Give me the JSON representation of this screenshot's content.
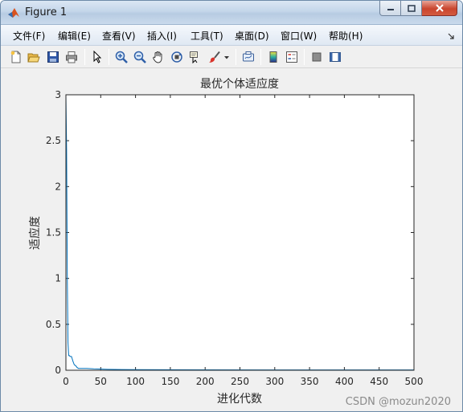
{
  "window": {
    "title": "Figure 1"
  },
  "menu": {
    "items": [
      "文件(F)",
      "编辑(E)",
      "查看(V)",
      "插入(I)",
      "工具(T)",
      "桌面(D)",
      "窗口(W)",
      "帮助(H)"
    ]
  },
  "toolbar": {
    "icons": [
      "new-figure-icon",
      "open-file-icon",
      "save-icon",
      "print-icon",
      "pointer-icon",
      "zoom-in-icon",
      "zoom-out-icon",
      "pan-icon",
      "rotate-3d-icon",
      "data-cursor-icon",
      "brush-icon",
      "brush-dropdown-icon",
      "link-plot-icon",
      "colorbar-icon",
      "legend-icon",
      "hide-plot-tools-icon",
      "show-plot-tools-icon"
    ]
  },
  "chart_data": {
    "type": "line",
    "title": "最优个体适应度",
    "xlabel": "进化代数",
    "ylabel": "适应度",
    "xlim": [
      0,
      500
    ],
    "ylim": [
      0,
      3
    ],
    "xticks": [
      "0",
      "50",
      "100",
      "150",
      "200",
      "250",
      "300",
      "350",
      "400",
      "450",
      "500"
    ],
    "yticks": [
      "0",
      "0.5",
      "1",
      "1.5",
      "2",
      "2.5",
      "3"
    ],
    "grid": false,
    "series": [
      {
        "color": "#0072bd",
        "x": [
          0,
          1,
          2,
          3,
          4,
          5,
          6,
          8,
          10,
          12,
          14,
          16,
          18,
          20,
          25,
          30,
          40,
          60,
          80,
          100,
          150,
          200,
          300,
          400,
          500
        ],
        "y": [
          3.0,
          2.4,
          1.0,
          0.3,
          0.16,
          0.16,
          0.15,
          0.15,
          0.1,
          0.06,
          0.05,
          0.03,
          0.02,
          0.02,
          0.02,
          0.02,
          0.015,
          0.01,
          0.008,
          0.006,
          0.005,
          0.004,
          0.003,
          0.003,
          0.003
        ]
      }
    ]
  },
  "watermark": "CSDN @mozun2020"
}
